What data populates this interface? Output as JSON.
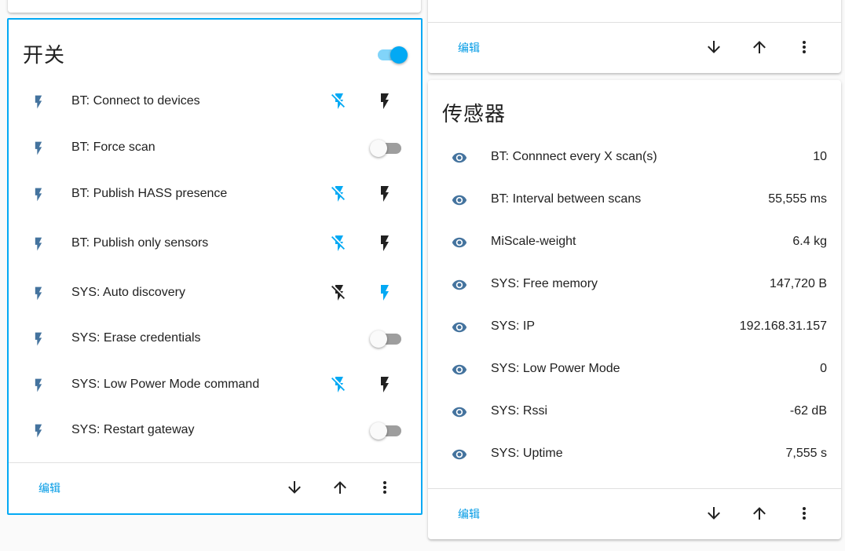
{
  "colors": {
    "accent": "#03a9f4",
    "icon_state": "#44739e",
    "text": "#212121"
  },
  "top_edit_card": {
    "edit_label": "编辑"
  },
  "switch_card": {
    "title": "开关",
    "header_toggle": "on",
    "edit_label": "编辑",
    "rows": [
      {
        "label": "BT: Connect to devices",
        "control": "buttons",
        "active": "on"
      },
      {
        "label": "BT: Force scan",
        "control": "toggle",
        "state": "off"
      },
      {
        "label": "BT: Publish HASS presence",
        "control": "buttons",
        "active": "on"
      },
      {
        "label": "BT: Publish only sensors",
        "control": "buttons",
        "active": "on"
      },
      {
        "label": "SYS: Auto discovery",
        "control": "buttons",
        "active": "off"
      },
      {
        "label": "SYS: Erase credentials",
        "control": "toggle",
        "state": "off"
      },
      {
        "label": "SYS: Low Power Mode command",
        "control": "buttons",
        "active": "on"
      },
      {
        "label": "SYS: Restart gateway",
        "control": "toggle",
        "state": "off"
      }
    ]
  },
  "sensor_card": {
    "title": "传感器",
    "edit_label": "编辑",
    "rows": [
      {
        "label": "BT: Connnect every X scan(s)",
        "value": "10"
      },
      {
        "label": "BT: Interval between scans",
        "value": "55,555 ms"
      },
      {
        "label": "MiScale-weight",
        "value": "6.4 kg"
      },
      {
        "label": "SYS: Free memory",
        "value": "147,720 B"
      },
      {
        "label": "SYS: IP",
        "value": "192.168.31.157"
      },
      {
        "label": "SYS: Low Power Mode",
        "value": "0"
      },
      {
        "label": "SYS: Rssi",
        "value": "-62 dB"
      },
      {
        "label": "SYS: Uptime",
        "value": "7,555 s"
      }
    ]
  },
  "icons": [
    "flash-icon",
    "flash-off-icon",
    "eye-icon",
    "arrow-down-icon",
    "arrow-up-icon",
    "more-vert-icon"
  ]
}
